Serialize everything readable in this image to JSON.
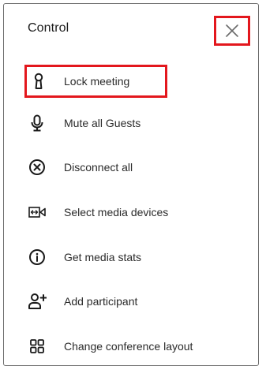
{
  "panel": {
    "title": "Control",
    "close_icon": "close-icon",
    "highlight_color": "#e3171d",
    "items": [
      {
        "label": "Lock meeting",
        "icon": "keyhole-icon",
        "highlighted": true
      },
      {
        "label": "Mute all Guests",
        "icon": "microphone-icon",
        "highlighted": false
      },
      {
        "label": "Disconnect all",
        "icon": "circle-x-icon",
        "highlighted": false
      },
      {
        "label": "Select media devices",
        "icon": "media-devices-icon",
        "highlighted": false
      },
      {
        "label": "Get media stats",
        "icon": "info-icon",
        "highlighted": false
      },
      {
        "label": "Add participant",
        "icon": "add-person-icon",
        "highlighted": false
      },
      {
        "label": "Change conference layout",
        "icon": "grid-layout-icon",
        "highlighted": false
      }
    ]
  }
}
